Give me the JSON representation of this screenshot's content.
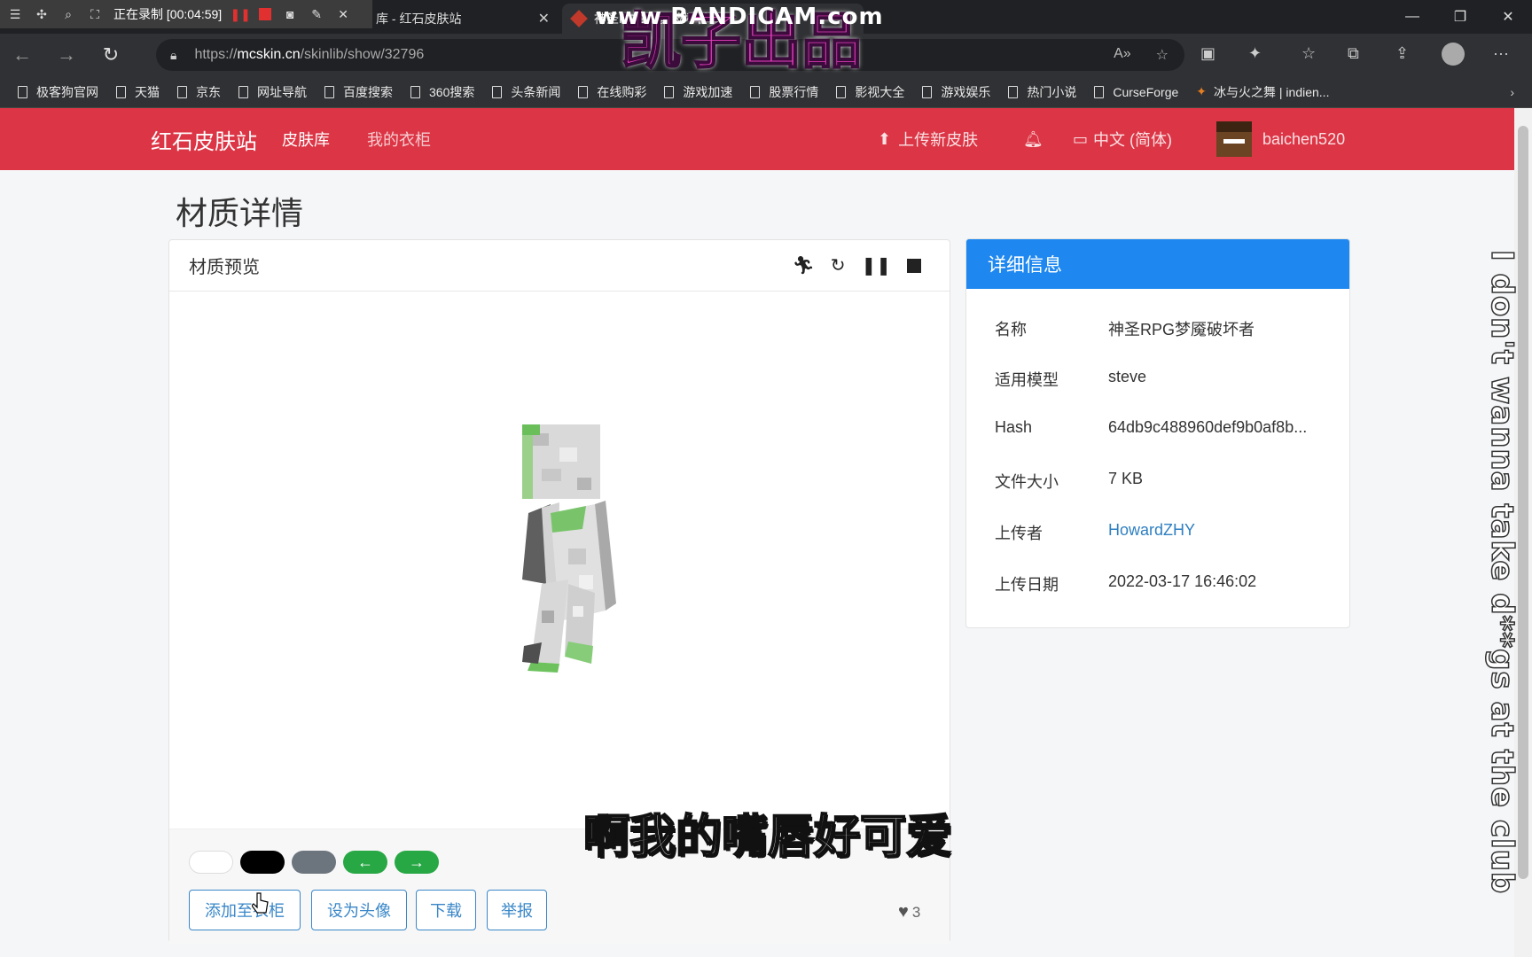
{
  "recorder": {
    "status": "正在录制 [00:04:59]"
  },
  "tabs": [
    {
      "title": "库 - 红石皮肤站"
    },
    {
      "title": "神圣RPG梦魇破坏者"
    }
  ],
  "address": {
    "url_prefix": "https://",
    "url_host": "mcskin.cn",
    "url_path": "/skinlib/show/32796"
  },
  "bookmarks": [
    {
      "label": "极客狗官网"
    },
    {
      "label": "天猫"
    },
    {
      "label": "京东"
    },
    {
      "label": "网址导航"
    },
    {
      "label": "百度搜索"
    },
    {
      "label": "360搜索"
    },
    {
      "label": "头条新闻"
    },
    {
      "label": "在线购彩"
    },
    {
      "label": "游戏加速"
    },
    {
      "label": "股票行情"
    },
    {
      "label": "影视大全"
    },
    {
      "label": "游戏娱乐"
    },
    {
      "label": "热门小说"
    },
    {
      "label": "CurseForge"
    },
    {
      "label": "冰与火之舞 | indien..."
    }
  ],
  "watermarks": {
    "bandicam": "www.BANDICAM.com",
    "maker": "凯子出品"
  },
  "site": {
    "brand": "红石皮肤站",
    "nav_skinlib": "皮肤库",
    "nav_closet": "我的衣柜",
    "upload": "上传新皮肤",
    "language": "中文 (简体)",
    "username": "baichen520"
  },
  "page": {
    "title": "材质详情"
  },
  "preview": {
    "title": "材质预览",
    "buttons": {
      "add_closet": "添加至衣柜",
      "set_avatar": "设为头像",
      "download": "下载",
      "report": "举报"
    },
    "likes": "3"
  },
  "details": {
    "title": "详细信息",
    "rows": [
      {
        "key": "名称",
        "value": "神圣RPG梦魇破坏者"
      },
      {
        "key": "适用模型",
        "value": "steve"
      },
      {
        "key": "Hash",
        "value": "64db9c488960def9b0af8b..."
      },
      {
        "key": "文件大小",
        "value": "7 KB"
      },
      {
        "key": "上传者",
        "value": "HowardZHY"
      },
      {
        "key": "上传日期",
        "value": "2022-03-17 16:46:02"
      }
    ]
  },
  "captions": {
    "side": "I don't wanna take d**gs at the club",
    "subtitle": "啊我的嘴唇好可爱"
  },
  "colors": {
    "navbar": "#dc3545",
    "info_header": "#1e88f0",
    "link": "#2f7fc1",
    "swatch_green": "#28a745"
  }
}
